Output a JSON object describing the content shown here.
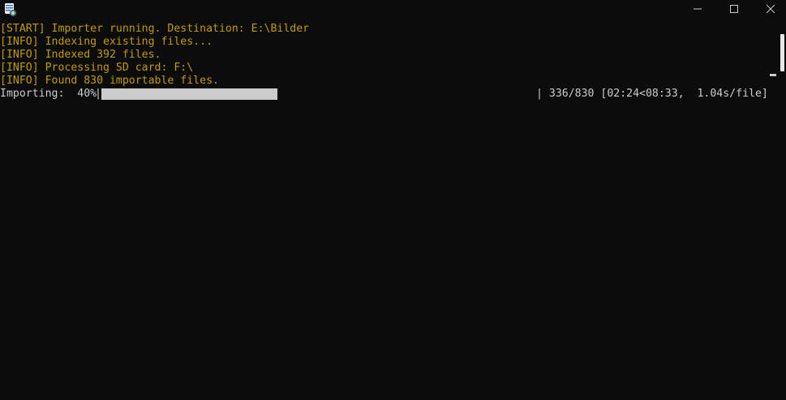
{
  "window": {
    "icon": "python-icon",
    "controls": {
      "minimize": "minimize-icon",
      "maximize": "maximize-icon",
      "close": "close-icon"
    }
  },
  "console": {
    "lines": [
      "[START] Importer running. Destination: E:\\Bilder",
      "[INFO] Indexing existing files...",
      "[INFO] Indexed 392 files.",
      "[INFO] Processing SD card: F:\\",
      "[INFO] Found 830 importable files."
    ],
    "progress": {
      "label": "Importing:  40%",
      "separator_left": "|",
      "stats": "| 336/830 [02:24<08:33,  1.04s/file]",
      "fraction": 0.405
    }
  },
  "colors": {
    "background": "#0c0c0c",
    "log_text": "#c19c00",
    "progress_text": "#cccccc",
    "progress_fill": "#cccccc"
  }
}
